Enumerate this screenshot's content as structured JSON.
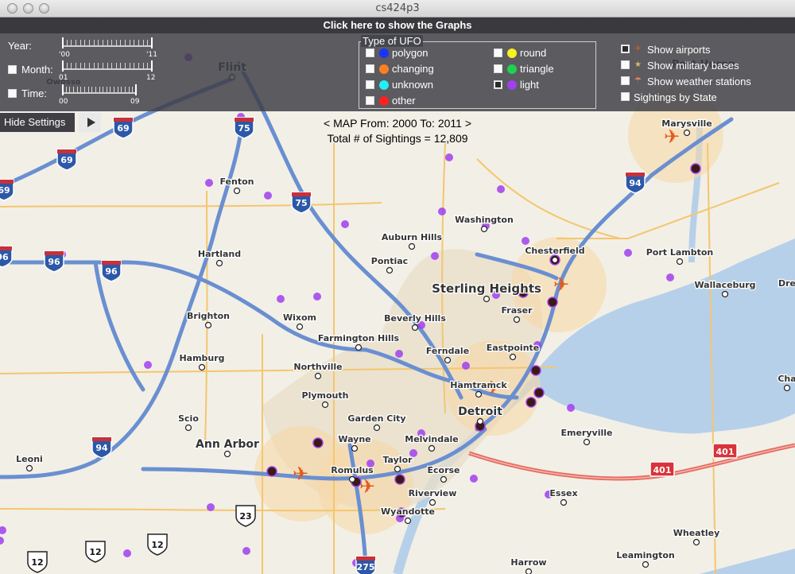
{
  "window": {
    "title": "cs424p3"
  },
  "graphs_bar": {
    "label": "Click here to show the Graphs"
  },
  "settings": {
    "year": {
      "label": "Year:",
      "min_label": "'00",
      "max_label": "'11",
      "checkbox": false
    },
    "month": {
      "label": "Month:",
      "min_label": "01",
      "max_label": "12",
      "checked": false
    },
    "time": {
      "label": "Time:",
      "min_label": "00",
      "max_label": "09",
      "checked": false
    },
    "ufo_types": {
      "title": "Type of UFO",
      "items": [
        {
          "label": "polygon",
          "color": "#1a33ff",
          "checked": false
        },
        {
          "label": "changing",
          "color": "#ff7f20",
          "checked": false
        },
        {
          "label": "unknown",
          "color": "#22f0f5",
          "checked": false
        },
        {
          "label": "other",
          "color": "#ff2020",
          "checked": false
        },
        {
          "label": "round",
          "color": "#f8f020",
          "checked": false
        },
        {
          "label": "triangle",
          "color": "#20d050",
          "checked": false
        },
        {
          "label": "light",
          "color": "#a040f0",
          "checked": true
        }
      ]
    },
    "layers": [
      {
        "label": "Show airports",
        "checked": true,
        "icon": "airport-icon"
      },
      {
        "label": "Show military bases",
        "checked": false,
        "icon": "military-base-icon"
      },
      {
        "label": "Show weather stations",
        "checked": false,
        "icon": "weather-station-icon"
      },
      {
        "label": "Sightings by State",
        "checked": false
      }
    ],
    "hide_label": "Hide Settings"
  },
  "map_info": {
    "range": "< MAP From: 2000 To: 2011 >",
    "total": "Total # of Sightings = 12,809"
  },
  "map_labels": {
    "flint": "Flint",
    "owosso": "Owosso",
    "port_huron": "Port Huron",
    "marysville": "Marysville",
    "fenton": "Fenton",
    "washington": "Washington",
    "auburn_hills": "Auburn Hills",
    "hartland": "Hartland",
    "pontiac": "Pontiac",
    "chesterfield": "Chesterfield",
    "port_lambton": "Port Lambton",
    "sterling_heights": "Sterling Heights",
    "wallaceburg": "Wallaceburg",
    "dre": "Dre",
    "fraser": "Fraser",
    "brighton": "Brighton",
    "wixom": "Wixom",
    "beverly_hills": "Beverly Hills",
    "farmington_hills": "Farmington Hills",
    "ferndale": "Ferndale",
    "eastpointe": "Eastpointe",
    "hamburg": "Hamburg",
    "northville": "Northville",
    "hamtramck": "Hamtramck",
    "plymouth": "Plymouth",
    "cha": "Cha",
    "scio": "Scio",
    "garden_city": "Garden City",
    "detroit": "Detroit",
    "wayne": "Wayne",
    "melvindale": "Melvindale",
    "emeryville": "Emeryville",
    "ann_arbor": "Ann Arbor",
    "taylor": "Taylor",
    "romulus": "Romulus",
    "ecorse": "Ecorse",
    "leoni": "Leoni",
    "riverview": "Riverview",
    "essex": "Essex",
    "wyandotte": "Wyandotte",
    "wheatley": "Wheatley",
    "leamington": "Leamington",
    "harrow": "Harrow"
  },
  "road_shields": {
    "i69": "69",
    "i75": "75",
    "i96": "96",
    "i94": "94",
    "i275": "275",
    "us23": "23",
    "us12": "12",
    "hwy401": "401"
  },
  "colors": {
    "settings_bg": "#3e3e46",
    "sighting_light": "#a040f0",
    "airport": "#e45a1a",
    "cluster": "#3a1a12"
  }
}
